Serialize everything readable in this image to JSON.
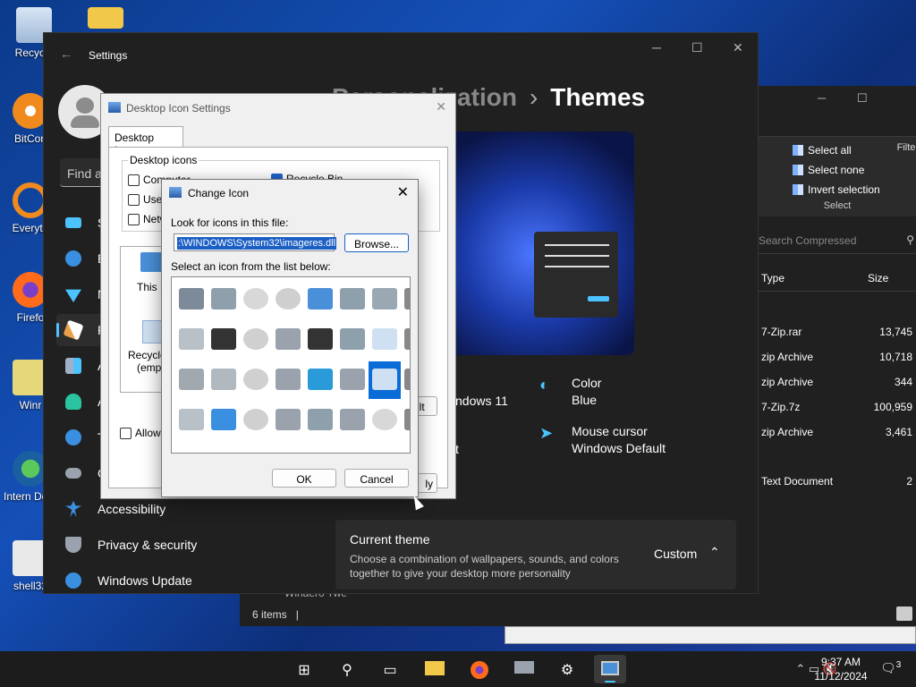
{
  "desktop": {
    "icons": [
      "Recycle",
      "BitCon",
      "Everyth",
      "Firefo",
      "Winr",
      "Intern Downl",
      "shell32"
    ]
  },
  "explorer": {
    "ribbon": {
      "select_all": "Select all",
      "select_none": "Select none",
      "invert_selection": "Invert selection",
      "group_label": "Select",
      "filter_label": "Filte"
    },
    "search_placeholder": "Search Compressed",
    "columns": {
      "type": "Type",
      "size": "Size"
    },
    "rows": [
      {
        "type": "7-Zip.rar",
        "size": "13,745"
      },
      {
        "type": "zip Archive",
        "size": "10,718"
      },
      {
        "type": "zip Archive",
        "size": "344"
      },
      {
        "type": "7-Zip.7z",
        "size": "100,959"
      },
      {
        "type": "zip Archive",
        "size": "3,461"
      },
      {
        "type": "Text Document",
        "size": "2"
      }
    ],
    "folder_label": "Winaero Twe",
    "status_items": "6 items",
    "status_sep": "|"
  },
  "settings": {
    "window_title": "Settings",
    "find_placeholder": "Find a",
    "heading_parent": "Personalization",
    "heading_current": "Themes",
    "nav": [
      "S",
      "B",
      "N",
      "P",
      "A",
      "A",
      "T",
      "G",
      "Accessibility",
      "Privacy & security",
      "Windows Update"
    ],
    "properties": {
      "color_label": "Color",
      "color_value": "Blue",
      "cursor_label": "Mouse cursor",
      "cursor_value": "Windows Default",
      "sound_partial": "ndows 11",
      "partial2": "t"
    },
    "current_theme": {
      "title": "Current theme",
      "description": "Choose a combination of wallpapers, sounds, and colors together to give your desktop more personality",
      "value": "Custom"
    }
  },
  "desktop_icon_settings": {
    "title": "Desktop Icon Settings",
    "tab": "Desktop Icons",
    "group_label": "Desktop icons",
    "checkboxes": [
      {
        "label": "Computer",
        "checked": false
      },
      {
        "label": "Recycle Bin",
        "checked": true
      },
      {
        "label": "User",
        "checked": false
      },
      {
        "label": "Netw",
        "checked": false
      }
    ],
    "icon_labels": [
      "This P",
      "Recycle",
      "(empt"
    ],
    "allow_label": "Allow t",
    "restore_label": "ult",
    "apply_label": "ly"
  },
  "change_icon": {
    "title": "Change Icon",
    "look_label": "Look for icons in this file:",
    "path_value": ":\\WINDOWS\\System32\\imageres.dll",
    "browse_label": "Browse...",
    "select_label": "Select an icon from the list below:",
    "ok_label": "OK",
    "cancel_label": "Cancel",
    "grid_icons": [
      "drive-floppy",
      "drive-green",
      "dvd-disc",
      "dvd-rw",
      "network-drive",
      "printer-check",
      "printer-green",
      "partial",
      "drive-gray",
      "sd-card",
      "dvd-r",
      "drive-small",
      "webcam",
      "printer-check",
      "recycle-full",
      "partial",
      "drive-x",
      "drive-flat",
      "dvd-ram",
      "drive-small",
      "tablet",
      "printer",
      "recycle-bin-selected",
      "partial",
      "drive-gray",
      "windows-drive",
      "dvd-rom",
      "drive-small",
      "printer-check",
      "printer",
      "dvd-disc",
      "partial"
    ]
  },
  "taskbar": {
    "time": "9:37 AM",
    "date": "11/12/2024",
    "notifications": "3"
  },
  "colors": {
    "accent": "#4cc2ff",
    "selection": "#0a6cd6",
    "settings_bg": "#202020",
    "dialog_bg": "#f0f0f0"
  }
}
